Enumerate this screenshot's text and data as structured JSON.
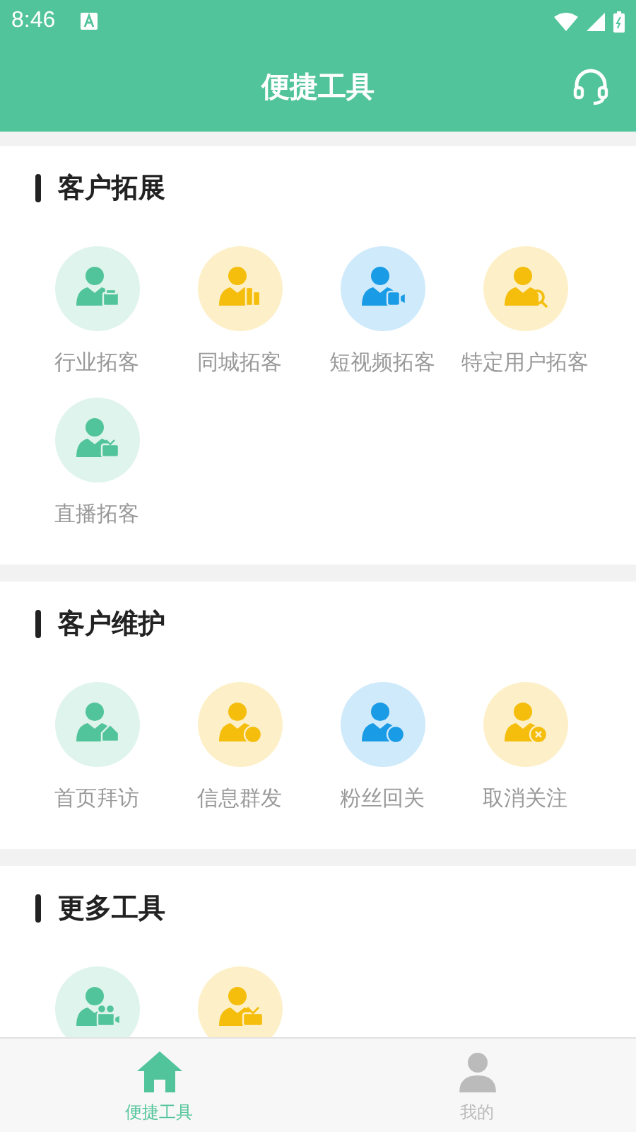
{
  "status_bar": {
    "time": "8:46"
  },
  "header": {
    "title": "便捷工具"
  },
  "sections": [
    {
      "title": "客户拓展",
      "items": [
        {
          "label": "行业拓客",
          "color": "#52c49b",
          "kind": "briefcase"
        },
        {
          "label": "同城拓客",
          "color": "#f5bd0c",
          "kind": "building"
        },
        {
          "label": "短视频拓客",
          "color": "#1a9be6",
          "kind": "camera"
        },
        {
          "label": "特定用户拓客",
          "color": "#f5bd0c",
          "kind": "search"
        },
        {
          "label": "直播拓客",
          "color": "#52c49b",
          "kind": "tv"
        }
      ]
    },
    {
      "title": "客户维护",
      "items": [
        {
          "label": "首页拜访",
          "color": "#52c49b",
          "kind": "home"
        },
        {
          "label": "信息群发",
          "color": "#f5bd0c",
          "kind": "chat"
        },
        {
          "label": "粉丝回关",
          "color": "#1a9be6",
          "kind": "swap"
        },
        {
          "label": "取消关注",
          "color": "#f5bd0c",
          "kind": "close"
        }
      ]
    },
    {
      "title": "更多工具",
      "items": [
        {
          "color": "#52c49b",
          "kind": "movie"
        },
        {
          "color": "#f5bd0c",
          "kind": "television"
        }
      ]
    }
  ],
  "tab_bar": [
    {
      "label": "便捷工具",
      "selected": true,
      "kind": "home"
    },
    {
      "label": "我的",
      "selected": false,
      "kind": "person"
    }
  ]
}
